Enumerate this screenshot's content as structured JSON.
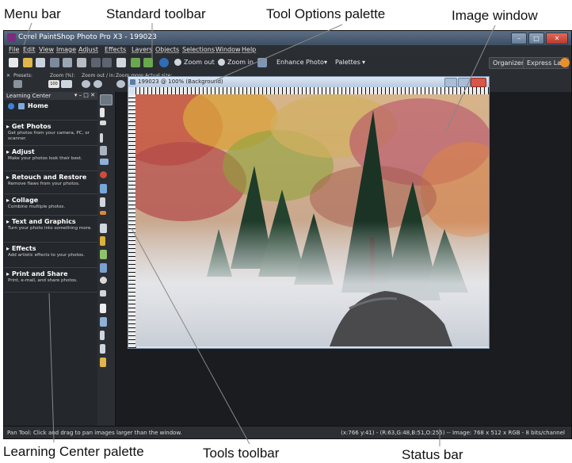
{
  "callouts": {
    "menu_bar": "Menu bar",
    "standard_toolbar": "Standard toolbar",
    "tool_options": "Tool Options palette",
    "image_window": "Image window",
    "learning_center": "Learning Center palette",
    "tools_toolbar": "Tools toolbar",
    "status_bar": "Status bar"
  },
  "window": {
    "title": "Corel PaintShop Photo Pro X3 - 199023"
  },
  "menu": {
    "items": [
      "File",
      "Edit",
      "View",
      "Image",
      "Adjust",
      "Effects",
      "Layers",
      "Objects",
      "Selections",
      "Window",
      "Help"
    ]
  },
  "toolbar": {
    "zoom_out": "Zoom out",
    "zoom_in": "Zoom in",
    "enhance_photo": "Enhance Photo",
    "palettes": "Palettes",
    "organizer": "Organizer",
    "express_lab": "Express Lab"
  },
  "tool_options": {
    "presets": "Presets:",
    "zoom_pct": "Zoom (%):",
    "zoom_value": "100",
    "zoom_out_in": "Zoom out / in:",
    "zoom_more": "Zoom more:",
    "actual_size": "Actual size:"
  },
  "learning_center": {
    "title": "Learning Center",
    "home": "Home",
    "sections": [
      {
        "title": "Get Photos",
        "desc": "Get photos from your camera, PC, or scanner."
      },
      {
        "title": "Adjust",
        "desc": "Make your photos look their best."
      },
      {
        "title": "Retouch and Restore",
        "desc": "Remove flaws from your photos."
      },
      {
        "title": "Collage",
        "desc": "Combine multiple photos."
      },
      {
        "title": "Text and Graphics",
        "desc": "Turn your photo into something more."
      },
      {
        "title": "Effects",
        "desc": "Add artistic effects to your photos."
      },
      {
        "title": "Print and Share",
        "desc": "Print, e-mail, and share photos."
      }
    ]
  },
  "image_window": {
    "title": "199023 @ 100% (Background)"
  },
  "status": {
    "left": "Pan Tool: Click and drag to pan images larger than the window.",
    "right": "(x:766 y:41) - (R:63,G:48,B:51,O:255) -- Image: 768 x 512 x RGB - 8 bits/channel"
  },
  "colors": {
    "accent": "#2f6db5",
    "workspace": "#1b1c1f",
    "panel": "#24272b"
  }
}
